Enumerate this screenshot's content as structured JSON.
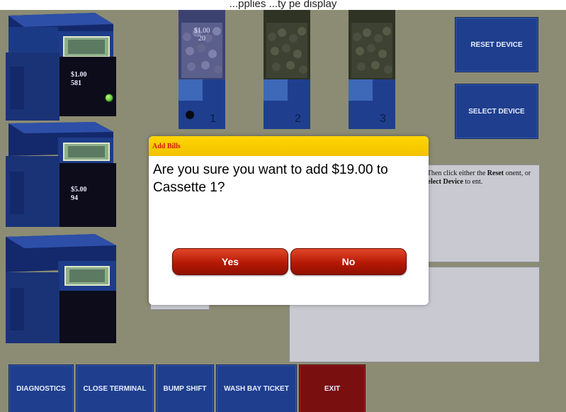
{
  "page": {
    "caption": "...pplies ...ty pe display"
  },
  "cassettes": [
    {
      "denomination": "$1.00",
      "count": "581",
      "status_led": "green"
    },
    {
      "denomination": "$5.00",
      "count": "94"
    },
    {
      "denomination": "",
      "count": ""
    }
  ],
  "hoppers": [
    {
      "denomination": "$1.00",
      "count": "20",
      "number": "1"
    },
    {
      "denomination": "",
      "count": "",
      "number": "2"
    },
    {
      "denomination": "",
      "count": "",
      "number": "3"
    }
  ],
  "side_buttons": {
    "reset_device": "RESET DEVICE",
    "select_device": "SELECT DEVICE"
  },
  "instructions": {
    "part1": ". Then click either the ",
    "reset": "Reset",
    "part2": " onent, or ",
    "select": "Select Device",
    "part3": " to ent."
  },
  "dialog": {
    "title": "Add Bills",
    "message": "Are you sure you want to add $19.00 to Cassette 1?",
    "yes_label": "Yes",
    "no_label": "No"
  },
  "toolbar": {
    "diagnostics": "DIAGNOSTICS",
    "close_terminal": "CLOSE TERMINAL",
    "bump_shift": "BUMP SHIFT",
    "wash_bay_ticket": "WASH BAY TICKET",
    "exit": "EXIT"
  },
  "colors": {
    "background": "#8c8c74",
    "button_blue": "#1f3f8e",
    "exit_red": "#7a0f10",
    "dialog_header": "#ffd500",
    "dialog_button": "#b51905"
  }
}
